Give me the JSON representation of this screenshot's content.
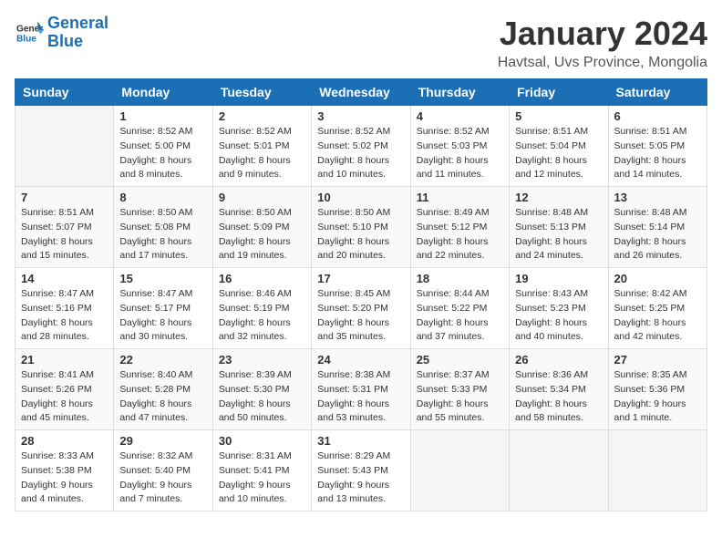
{
  "logo": {
    "line1": "General",
    "line2": "Blue"
  },
  "title": "January 2024",
  "subtitle": "Havtsal, Uvs Province, Mongolia",
  "headers": [
    "Sunday",
    "Monday",
    "Tuesday",
    "Wednesday",
    "Thursday",
    "Friday",
    "Saturday"
  ],
  "weeks": [
    [
      {
        "day": "",
        "info": ""
      },
      {
        "day": "1",
        "info": "Sunrise: 8:52 AM\nSunset: 5:00 PM\nDaylight: 8 hours\nand 8 minutes."
      },
      {
        "day": "2",
        "info": "Sunrise: 8:52 AM\nSunset: 5:01 PM\nDaylight: 8 hours\nand 9 minutes."
      },
      {
        "day": "3",
        "info": "Sunrise: 8:52 AM\nSunset: 5:02 PM\nDaylight: 8 hours\nand 10 minutes."
      },
      {
        "day": "4",
        "info": "Sunrise: 8:52 AM\nSunset: 5:03 PM\nDaylight: 8 hours\nand 11 minutes."
      },
      {
        "day": "5",
        "info": "Sunrise: 8:51 AM\nSunset: 5:04 PM\nDaylight: 8 hours\nand 12 minutes."
      },
      {
        "day": "6",
        "info": "Sunrise: 8:51 AM\nSunset: 5:05 PM\nDaylight: 8 hours\nand 14 minutes."
      }
    ],
    [
      {
        "day": "7",
        "info": "Sunrise: 8:51 AM\nSunset: 5:07 PM\nDaylight: 8 hours\nand 15 minutes."
      },
      {
        "day": "8",
        "info": "Sunrise: 8:50 AM\nSunset: 5:08 PM\nDaylight: 8 hours\nand 17 minutes."
      },
      {
        "day": "9",
        "info": "Sunrise: 8:50 AM\nSunset: 5:09 PM\nDaylight: 8 hours\nand 19 minutes."
      },
      {
        "day": "10",
        "info": "Sunrise: 8:50 AM\nSunset: 5:10 PM\nDaylight: 8 hours\nand 20 minutes."
      },
      {
        "day": "11",
        "info": "Sunrise: 8:49 AM\nSunset: 5:12 PM\nDaylight: 8 hours\nand 22 minutes."
      },
      {
        "day": "12",
        "info": "Sunrise: 8:48 AM\nSunset: 5:13 PM\nDaylight: 8 hours\nand 24 minutes."
      },
      {
        "day": "13",
        "info": "Sunrise: 8:48 AM\nSunset: 5:14 PM\nDaylight: 8 hours\nand 26 minutes."
      }
    ],
    [
      {
        "day": "14",
        "info": "Sunrise: 8:47 AM\nSunset: 5:16 PM\nDaylight: 8 hours\nand 28 minutes."
      },
      {
        "day": "15",
        "info": "Sunrise: 8:47 AM\nSunset: 5:17 PM\nDaylight: 8 hours\nand 30 minutes."
      },
      {
        "day": "16",
        "info": "Sunrise: 8:46 AM\nSunset: 5:19 PM\nDaylight: 8 hours\nand 32 minutes."
      },
      {
        "day": "17",
        "info": "Sunrise: 8:45 AM\nSunset: 5:20 PM\nDaylight: 8 hours\nand 35 minutes."
      },
      {
        "day": "18",
        "info": "Sunrise: 8:44 AM\nSunset: 5:22 PM\nDaylight: 8 hours\nand 37 minutes."
      },
      {
        "day": "19",
        "info": "Sunrise: 8:43 AM\nSunset: 5:23 PM\nDaylight: 8 hours\nand 40 minutes."
      },
      {
        "day": "20",
        "info": "Sunrise: 8:42 AM\nSunset: 5:25 PM\nDaylight: 8 hours\nand 42 minutes."
      }
    ],
    [
      {
        "day": "21",
        "info": "Sunrise: 8:41 AM\nSunset: 5:26 PM\nDaylight: 8 hours\nand 45 minutes."
      },
      {
        "day": "22",
        "info": "Sunrise: 8:40 AM\nSunset: 5:28 PM\nDaylight: 8 hours\nand 47 minutes."
      },
      {
        "day": "23",
        "info": "Sunrise: 8:39 AM\nSunset: 5:30 PM\nDaylight: 8 hours\nand 50 minutes."
      },
      {
        "day": "24",
        "info": "Sunrise: 8:38 AM\nSunset: 5:31 PM\nDaylight: 8 hours\nand 53 minutes."
      },
      {
        "day": "25",
        "info": "Sunrise: 8:37 AM\nSunset: 5:33 PM\nDaylight: 8 hours\nand 55 minutes."
      },
      {
        "day": "26",
        "info": "Sunrise: 8:36 AM\nSunset: 5:34 PM\nDaylight: 8 hours\nand 58 minutes."
      },
      {
        "day": "27",
        "info": "Sunrise: 8:35 AM\nSunset: 5:36 PM\nDaylight: 9 hours\nand 1 minute."
      }
    ],
    [
      {
        "day": "28",
        "info": "Sunrise: 8:33 AM\nSunset: 5:38 PM\nDaylight: 9 hours\nand 4 minutes."
      },
      {
        "day": "29",
        "info": "Sunrise: 8:32 AM\nSunset: 5:40 PM\nDaylight: 9 hours\nand 7 minutes."
      },
      {
        "day": "30",
        "info": "Sunrise: 8:31 AM\nSunset: 5:41 PM\nDaylight: 9 hours\nand 10 minutes."
      },
      {
        "day": "31",
        "info": "Sunrise: 8:29 AM\nSunset: 5:43 PM\nDaylight: 9 hours\nand 13 minutes."
      },
      {
        "day": "",
        "info": ""
      },
      {
        "day": "",
        "info": ""
      },
      {
        "day": "",
        "info": ""
      }
    ]
  ]
}
